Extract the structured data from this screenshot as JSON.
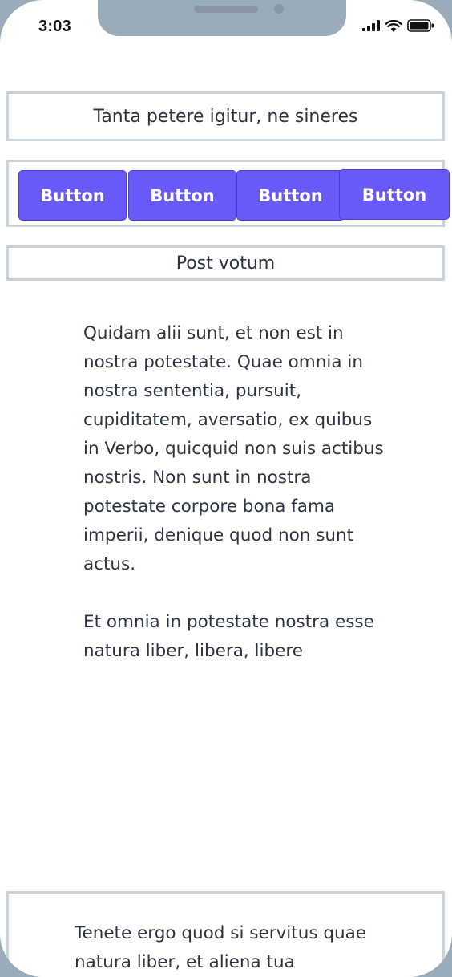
{
  "status_bar": {
    "time": "3:03",
    "icons": [
      "cellular-signal-icon",
      "wifi-icon",
      "battery-icon"
    ]
  },
  "header": {
    "title": "Tanta petere igitur, ne sineres"
  },
  "buttons": [
    {
      "label": "Button"
    },
    {
      "label": "Button"
    },
    {
      "label": "Button"
    },
    {
      "label": "Button"
    }
  ],
  "subheader": {
    "label": "Post votum"
  },
  "body": {
    "paragraphs": [
      "Quidam alii sunt, et non est in nostra potestate. Quae omnia in nostra sententia, pursuit, cupiditatem, aversatio, ex quibus in Verbo, quicquid non suis actibus nostris. Non sunt in nostra potestate corpore bona fama imperii, denique quod non sunt actus.",
      "Et omnia in potestate nostra esse natura liber, libera, libere"
    ]
  },
  "footer_card": {
    "text": "Tenete ergo quod si servitus quae natura liber, et aliena tua"
  },
  "colors": {
    "button_bg": "#675af7",
    "box_border": "#c9d3da",
    "text": "#2b3440",
    "frame": "#9aabb9"
  }
}
